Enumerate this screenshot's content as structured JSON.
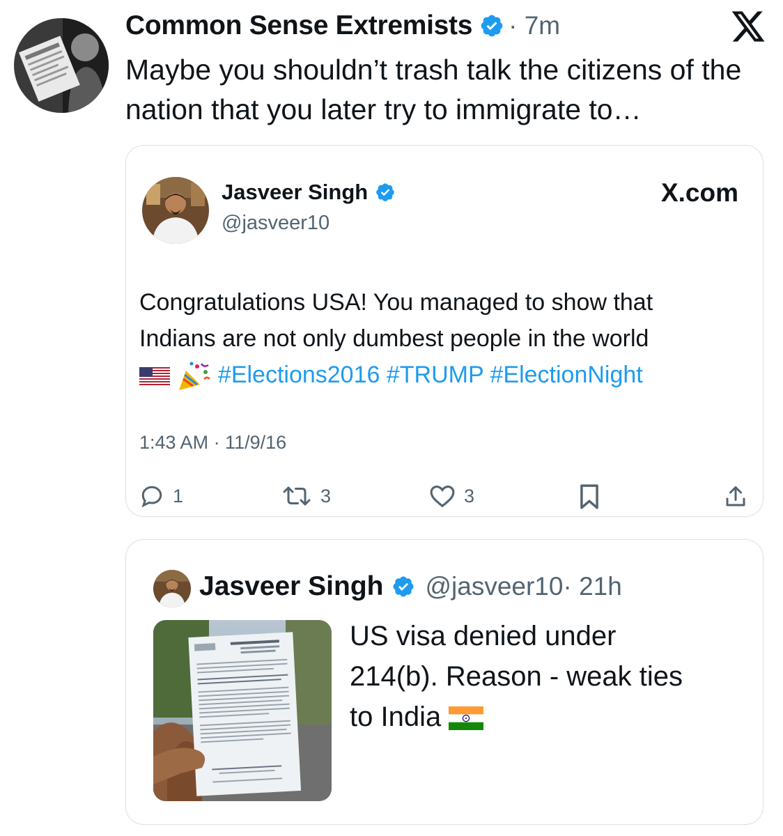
{
  "post": {
    "author_name": "Common Sense Extremists",
    "time": "· 7m",
    "text": "Maybe you shouldn’t trash talk the citizens of the nation that you later try to immigrate to…",
    "avatar_icon": "profile-photo",
    "platform_icon": "x-logo"
  },
  "quote_card_1": {
    "author_name": "Jasveer Singh",
    "handle": "@jasveer10",
    "source_label": "X.com",
    "text_line_1": "Congratulations USA! You managed to show that",
    "text_line_2": "Indians are not only dumbest people in the world",
    "emoji_flag": "us-flag",
    "emoji_party": "party-popper",
    "hashtags": [
      "#Elections2016",
      "#TRUMP",
      "#ElectionNight"
    ],
    "timestamp": "1:43 AM · 11/9/16",
    "actions": {
      "reply_count": "1",
      "retweet_count": "3",
      "like_count": "3"
    }
  },
  "quote_card_2": {
    "author_name": "Jasveer Singh",
    "handle": "@jasveer10",
    "time": "· 21h",
    "text_line_1": "US visa denied under",
    "text_line_2": "214(b). Reason - weak ties",
    "text_line_3": "to India",
    "emoji_flag": "india-flag",
    "photo_icon": "visa-letter-photo"
  },
  "colors": {
    "verified_blue": "#1d9bf0",
    "secondary_text": "#536471",
    "card_border": "#dcdfe3"
  }
}
